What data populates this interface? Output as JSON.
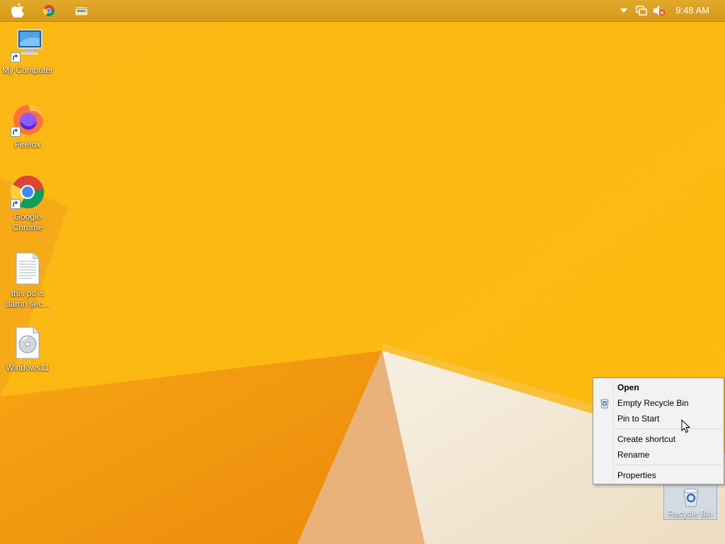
{
  "topbar": {
    "icons": [
      "apple-icon",
      "chrome-icon",
      "file-explorer-icon"
    ],
    "tray_icons": [
      "tray-overflow-chevron-icon",
      "network-icon",
      "volume-muted-icon"
    ],
    "clock": "9:48 AM"
  },
  "desktop": {
    "icons": [
      {
        "label": "My Computer",
        "icon": "computer-icon"
      },
      {
        "label": "Firefox",
        "icon": "firefox-icon"
      },
      {
        "label": "Google Chrome",
        "icon": "chrome-icon"
      },
      {
        "label": "this pc is damn sec...",
        "icon": "text-file-icon"
      },
      {
        "label": "Windows11",
        "icon": "disc-image-icon"
      }
    ],
    "recycle_bin": {
      "label": "Recycle Bin",
      "icon": "recycle-bin-icon",
      "selected": true
    }
  },
  "context_menu": {
    "items": [
      {
        "label": "Open",
        "bold": true
      },
      {
        "label": "Empty Recycle Bin",
        "icon": "recycle-bin-small-icon"
      },
      {
        "label": "Pin to Start"
      },
      {
        "label": "Create shortcut"
      },
      {
        "label": "Rename"
      },
      {
        "label": "Properties"
      }
    ]
  },
  "colors": {
    "wallpaper_main": "#fdb913",
    "wallpaper_dark": "#f39c12",
    "wallpaper_light": "#f4ead7",
    "topbar": "#d9a020"
  }
}
